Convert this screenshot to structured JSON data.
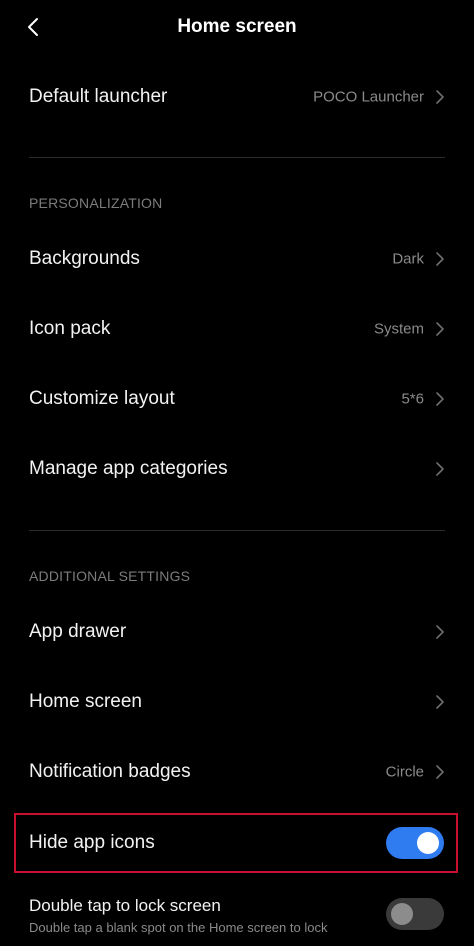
{
  "header": {
    "title": "Home screen",
    "back_icon": "chevron-left-icon"
  },
  "default_launcher": {
    "label": "Default launcher",
    "value": "POCO Launcher"
  },
  "personalization": {
    "section_title": "PERSONALIZATION",
    "items": [
      {
        "label": "Backgrounds",
        "value": "Dark"
      },
      {
        "label": "Icon pack",
        "value": "System"
      },
      {
        "label": "Customize layout",
        "value": "5*6"
      },
      {
        "label": "Manage app categories",
        "value": ""
      }
    ]
  },
  "additional": {
    "section_title": "ADDITIONAL SETTINGS",
    "items": [
      {
        "label": "App drawer",
        "value": ""
      },
      {
        "label": "Home screen",
        "value": ""
      },
      {
        "label": "Notification badges",
        "value": "Circle"
      }
    ]
  },
  "hide_app_icons": {
    "label": "Hide app icons",
    "enabled": true
  },
  "double_tap_lock": {
    "label": "Double tap to lock screen",
    "description": "Double tap a blank spot on the Home screen to lock",
    "enabled": false
  },
  "colors": {
    "background": "#000000",
    "toggle_on": "#2f7bf0",
    "highlight_border": "#c8102e"
  }
}
